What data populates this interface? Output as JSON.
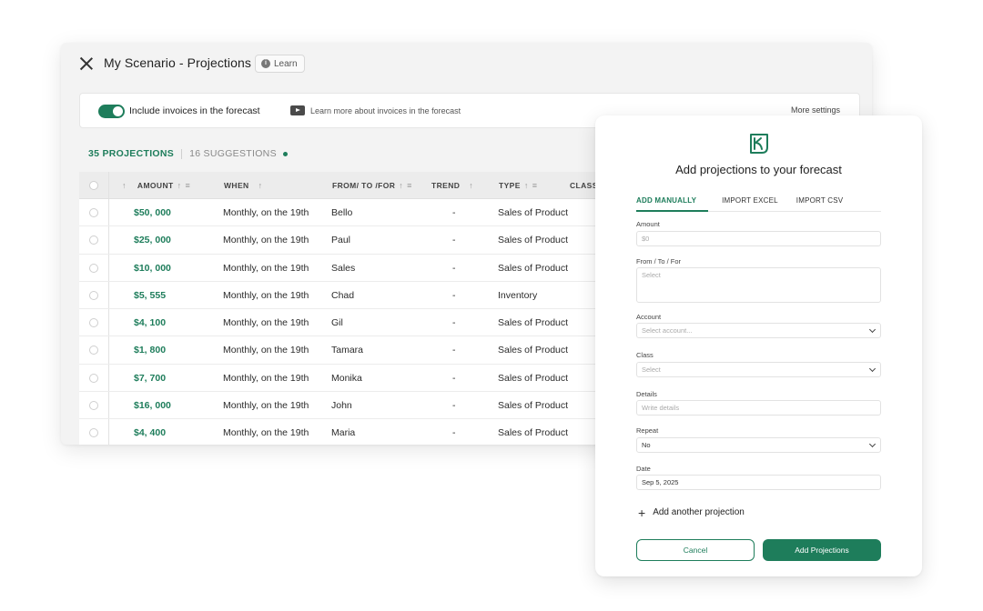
{
  "colors": {
    "accent": "#1e7d5b",
    "background": "#f3f3f3",
    "panel": "#ffffff"
  },
  "window": {
    "title": "My Scenario - Projections",
    "learn_label": "Learn",
    "close_icon": "close-icon"
  },
  "settings": {
    "toggle_label": "Include invoices in the forecast",
    "toggle_on": true,
    "video_link": "Learn more about invoices in the forecast",
    "more_settings": "More settings"
  },
  "tabs": {
    "projections": "35 PROJECTIONS",
    "suggestions": "16 SUGGESTIONS"
  },
  "table": {
    "headers": {
      "amount": "AMOUNT",
      "when": "WHEN",
      "from": "FROM/ TO /FOR",
      "trend": "TREND",
      "type": "TYPE",
      "class": "CLASS"
    },
    "rows": [
      {
        "amount": "$50, 000",
        "when": "Monthly, on the 19th",
        "from": "Bello",
        "trend": "-",
        "type": "Sales of Product"
      },
      {
        "amount": "$25, 000",
        "when": "Monthly, on the 19th",
        "from": "Paul",
        "trend": "-",
        "type": "Sales of Product"
      },
      {
        "amount": "$10, 000",
        "when": "Monthly, on the 19th",
        "from": "Sales",
        "trend": "-",
        "type": "Sales of Product"
      },
      {
        "amount": "$5, 555",
        "when": "Monthly, on the 19th",
        "from": "Chad",
        "trend": "-",
        "type": "Inventory"
      },
      {
        "amount": "$4, 100",
        "when": "Monthly, on the 19th",
        "from": "Gil",
        "trend": "-",
        "type": "Sales of Product"
      },
      {
        "amount": "$1, 800",
        "when": "Monthly, on the 19th",
        "from": "Tamara",
        "trend": "-",
        "type": "Sales of Product"
      },
      {
        "amount": "$7, 700",
        "when": "Monthly, on the 19th",
        "from": "Monika",
        "trend": "-",
        "type": "Sales of Product"
      },
      {
        "amount": "$16, 000",
        "when": "Monthly, on the 19th",
        "from": "John",
        "trend": "-",
        "type": "Sales of Product"
      },
      {
        "amount": "$4, 400",
        "when": "Monthly, on the 19th",
        "from": "Maria",
        "trend": "-",
        "type": "Sales of Product"
      }
    ]
  },
  "panel": {
    "title": "Add projections to your forecast",
    "tabs": [
      "ADD MANUALLY",
      "IMPORT EXCEL",
      "IMPORT CSV"
    ],
    "fields": {
      "amount": {
        "label": "Amount",
        "placeholder": "$0"
      },
      "from": {
        "label": "From / To / For",
        "placeholder": "Select"
      },
      "account": {
        "label": "Account",
        "placeholder": "Select account..."
      },
      "class": {
        "label": "Class",
        "placeholder": "Select"
      },
      "details": {
        "label": "Details",
        "placeholder": "Write details"
      },
      "repeat": {
        "label": "Repeat",
        "value": "No"
      },
      "date": {
        "label": "Date",
        "value": "Sep 5, 2025"
      }
    },
    "add_another": "Add another projection",
    "cancel": "Cancel",
    "submit": "Add Projections"
  }
}
